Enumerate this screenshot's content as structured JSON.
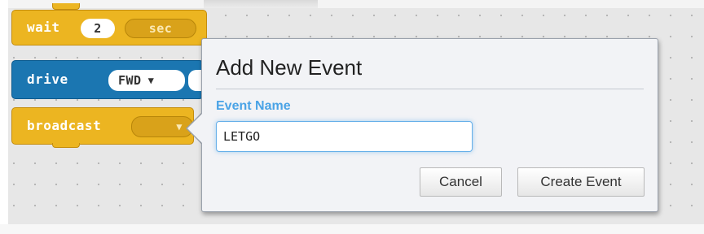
{
  "workspace": {
    "blocks": [
      {
        "keyword": "wait",
        "value": "2",
        "unit": "sec"
      },
      {
        "keyword": "drive",
        "direction": "FWD"
      },
      {
        "keyword": "broadcast",
        "dropdown_arrow": "▼"
      }
    ]
  },
  "dialog": {
    "title": "Add New Event",
    "field_label": "Event Name",
    "input_value": "LETGO",
    "cancel_label": "Cancel",
    "create_label": "Create Event"
  },
  "colors": {
    "block_yellow": "#ecb521",
    "block_blue": "#1b76b1",
    "label_blue": "#4aa3e6"
  }
}
